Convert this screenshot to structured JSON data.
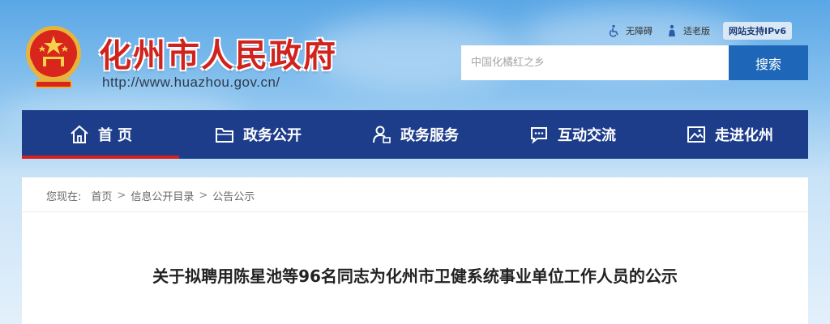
{
  "header": {
    "site_title": "化州市人民政府",
    "site_url": "http://www.huazhou.gov.cn/",
    "top_links": [
      {
        "label": "无障碍",
        "icon": "accessibility-icon"
      },
      {
        "label": "适老版",
        "icon": "elderly-mode-icon"
      }
    ],
    "ipv6_badge": "网站支持IPv6",
    "search": {
      "placeholder": "中国化橘红之乡",
      "button_label": "搜索"
    }
  },
  "nav": {
    "items": [
      {
        "label": "首 页",
        "icon": "home-icon",
        "active": true
      },
      {
        "label": "政务公开",
        "icon": "folder-icon",
        "active": false
      },
      {
        "label": "政务服务",
        "icon": "user-service-icon",
        "active": false
      },
      {
        "label": "互动交流",
        "icon": "chat-icon",
        "active": false
      },
      {
        "label": "走进化州",
        "icon": "picture-icon",
        "active": false
      }
    ]
  },
  "breadcrumb": {
    "prefix": "您现在:",
    "items": [
      "首页",
      "信息公开目录",
      "公告公示"
    ],
    "separator": ">"
  },
  "article": {
    "title": "关于拟聘用陈星池等96名同志为化州市卫健系统事业单位工作人员的公示"
  },
  "colors": {
    "title_red": "#d1231d",
    "nav_blue": "#1d3d8a",
    "search_blue": "#1e67b8",
    "active_underline": "#d61f1f"
  }
}
